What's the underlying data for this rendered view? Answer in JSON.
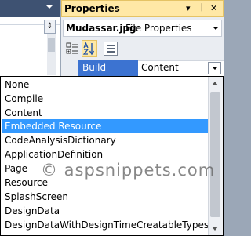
{
  "properties_panel": {
    "title": "Properties",
    "title_buttons": [
      "▾",
      "ᛁ",
      "✕"
    ],
    "file_name": "Mudassar.jpg",
    "file_type": "File Properties",
    "property": {
      "name": "Build Action",
      "value": "Content"
    }
  },
  "splitter_glyph": "⇕",
  "dropdown": {
    "options": [
      "None",
      "Compile",
      "Content",
      "Embedded Resource",
      "CodeAnalysisDictionary",
      "ApplicationDefinition",
      "Page",
      "Resource",
      "SplashScreen",
      "DesignData",
      "DesignDataWithDesignTimeCreatableTypes"
    ],
    "selected": "Embedded Resource"
  },
  "watermark": "© aspsnippets.com",
  "colors": {
    "selection": "#3399ff",
    "title_bar": "#ffe8a6",
    "property_label": "#3c73d1"
  }
}
